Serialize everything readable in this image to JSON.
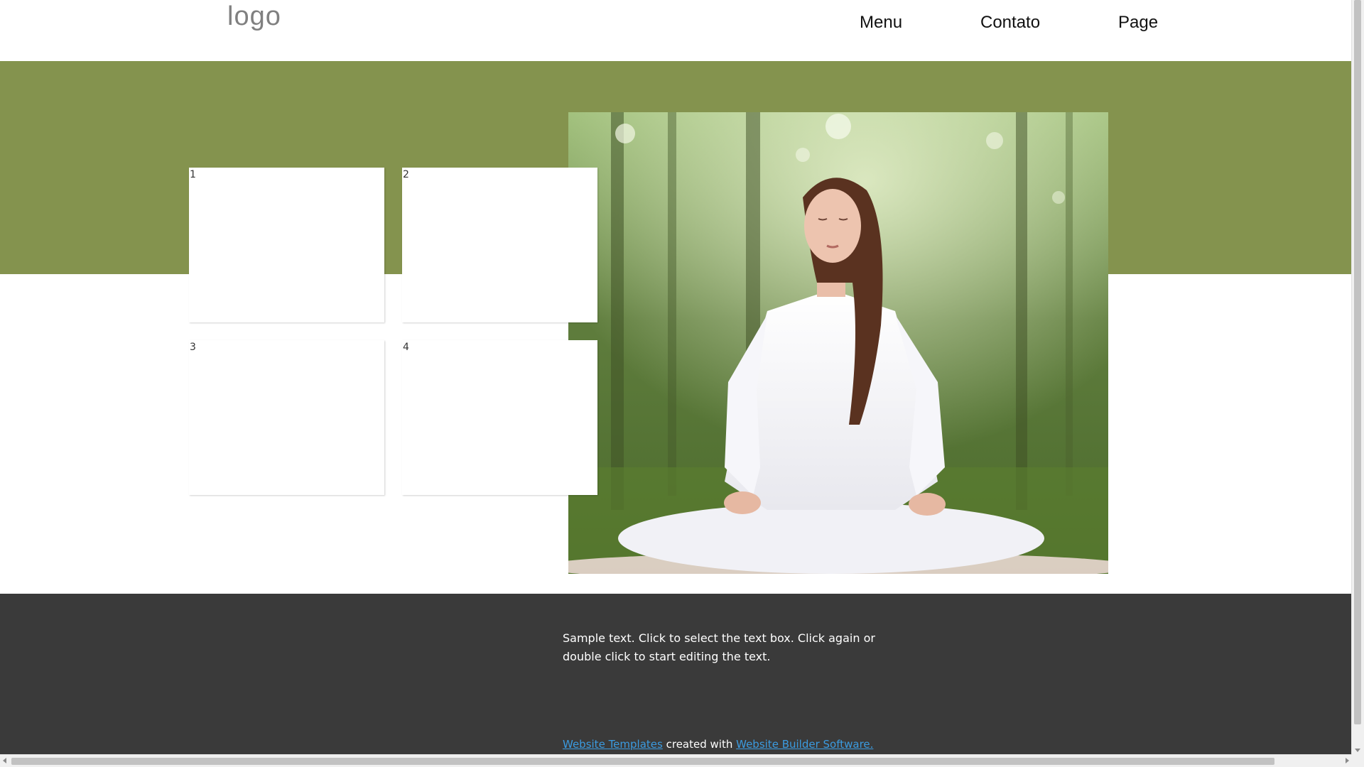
{
  "header": {
    "logo": "logo",
    "nav": [
      {
        "label": "Menu"
      },
      {
        "label": "Contato"
      },
      {
        "label": "Page"
      }
    ]
  },
  "hero": {
    "colors": {
      "band": "#84934e",
      "white_box": "#ffffff"
    },
    "boxes": [
      {
        "label": "1"
      },
      {
        "label": "2"
      },
      {
        "label": "3"
      },
      {
        "label": "4"
      }
    ],
    "image": {
      "subject": "woman-meditating-in-forest-photo"
    }
  },
  "footer": {
    "sample_text": "Sample text. Click to select the text box. Click again or double click to start editing the text.",
    "credit": {
      "link1": "Website Templates",
      "middle": "created with",
      "link2": "Website Builder Software."
    },
    "colors": {
      "background": "#3a3a3a",
      "link": "#3b9be0"
    }
  }
}
